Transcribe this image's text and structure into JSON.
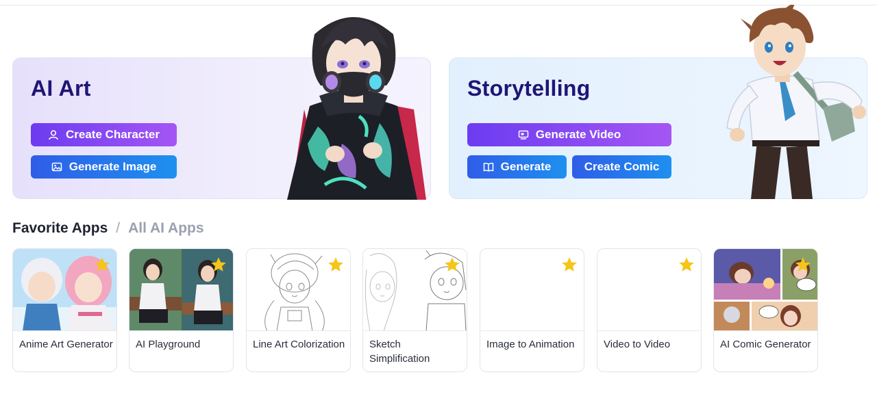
{
  "hero_ai": {
    "title": "AI Art",
    "buttons": [
      {
        "label": "Create Character",
        "icon": "person-icon"
      },
      {
        "label": "Generate Image",
        "icon": "image-icon"
      }
    ]
  },
  "hero_story": {
    "title": "Storytelling",
    "buttons": [
      {
        "label": "Generate Video",
        "icon": "video-icon"
      },
      {
        "label": "Generate",
        "icon": "book-icon"
      },
      {
        "label": "Create Comic",
        "icon": ""
      }
    ]
  },
  "section": {
    "favorite": "Favorite Apps",
    "separator": "/",
    "all": "All AI Apps"
  },
  "apps": [
    {
      "title": "Anime Art Generator",
      "favorite": true
    },
    {
      "title": "AI Playground",
      "favorite": true
    },
    {
      "title": "Line Art Colorization",
      "favorite": true
    },
    {
      "title": "Sketch Simplification",
      "favorite": true
    },
    {
      "title": "Image to Animation",
      "favorite": true
    },
    {
      "title": "Video to Video",
      "favorite": true
    },
    {
      "title": "AI Comic Generator",
      "favorite": true
    }
  ],
  "colors": {
    "title": "#1f1576",
    "purple_start": "#6c3cf0",
    "purple_end": "#a456f3",
    "blue_start": "#2f5de8",
    "blue_end": "#1e90ef",
    "star": "#f5c518"
  }
}
